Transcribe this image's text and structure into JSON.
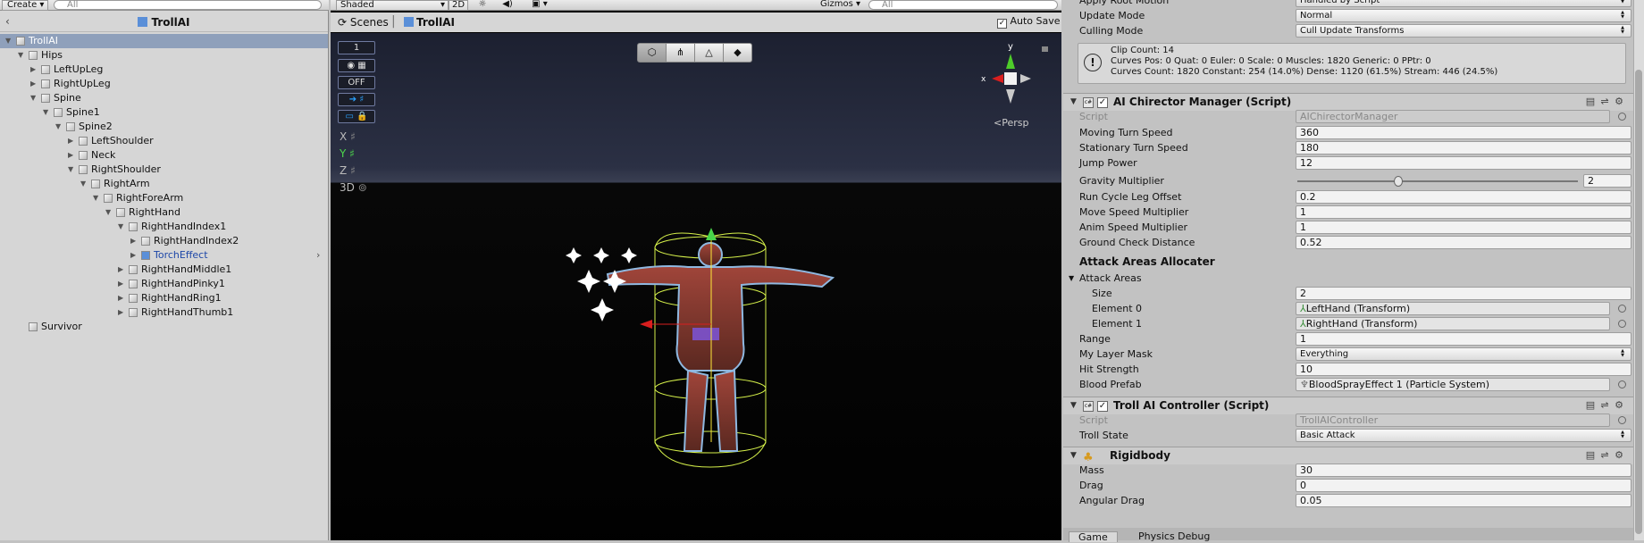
{
  "hierarchy": {
    "create_label": "Create",
    "search_placeholder": "All",
    "scene_title": "TrollAI",
    "items": [
      {
        "label": "TrollAI",
        "indent": 0,
        "arrow": "open",
        "selected": true
      },
      {
        "label": "Hips",
        "indent": 1,
        "arrow": "open"
      },
      {
        "label": "LeftUpLeg",
        "indent": 2,
        "arrow": "closed"
      },
      {
        "label": "RightUpLeg",
        "indent": 2,
        "arrow": "closed"
      },
      {
        "label": "Spine",
        "indent": 2,
        "arrow": "open"
      },
      {
        "label": "Spine1",
        "indent": 3,
        "arrow": "open"
      },
      {
        "label": "Spine2",
        "indent": 4,
        "arrow": "open"
      },
      {
        "label": "LeftShoulder",
        "indent": 5,
        "arrow": "closed"
      },
      {
        "label": "Neck",
        "indent": 5,
        "arrow": "closed"
      },
      {
        "label": "RightShoulder",
        "indent": 5,
        "arrow": "open"
      },
      {
        "label": "RightArm",
        "indent": 6,
        "arrow": "open"
      },
      {
        "label": "RightForeArm",
        "indent": 7,
        "arrow": "open"
      },
      {
        "label": "RightHand",
        "indent": 8,
        "arrow": "open"
      },
      {
        "label": "RightHandIndex1",
        "indent": 9,
        "arrow": "open"
      },
      {
        "label": "RightHandIndex2",
        "indent": 10,
        "arrow": "closed"
      },
      {
        "label": "TorchEffect",
        "indent": 10,
        "arrow": "closed",
        "prefab": true
      },
      {
        "label": "RightHandMiddle1",
        "indent": 9,
        "arrow": "closed"
      },
      {
        "label": "RightHandPinky1",
        "indent": 9,
        "arrow": "closed"
      },
      {
        "label": "RightHandRing1",
        "indent": 9,
        "arrow": "closed"
      },
      {
        "label": "RightHandThumb1",
        "indent": 9,
        "arrow": "closed"
      },
      {
        "label": "Survivor",
        "indent": 1,
        "arrow": "none"
      }
    ]
  },
  "scene_view": {
    "shading_mode": "Shaded",
    "mode_2d": "2D",
    "gizmos_label": "Gizmos",
    "search_placeholder": "All",
    "breadcrumb_root": "Scenes",
    "breadcrumb_current": "TrollAI",
    "auto_save_label": "Auto Save",
    "persp_label": "Persp",
    "left_controls": [
      "1",
      "",
      "OFF",
      "",
      ""
    ],
    "axes": [
      "X",
      "Y",
      "Z",
      "3D"
    ]
  },
  "inspector": {
    "top_rows": [
      {
        "label": "Apply Root Motion",
        "value": "Handled by Script"
      },
      {
        "label": "Update Mode",
        "value": "Normal"
      },
      {
        "label": "Culling Mode",
        "value": "Cull Update Transforms"
      }
    ],
    "info_lines": [
      "Clip Count: 14",
      "Curves Pos: 0 Quat: 0 Euler: 0 Scale: 0 Muscles: 1820 Generic: 0 PPtr: 0",
      "Curves Count: 1820 Constant: 254 (14.0%) Dense: 1120 (61.5%) Stream: 446 (24.5%)"
    ],
    "ai_manager": {
      "title": "AI Chirector Manager (Script)",
      "script_label": "Script",
      "script_value": "AIChirectorManager",
      "rows": [
        {
          "label": "Moving Turn Speed",
          "value": "360"
        },
        {
          "label": "Stationary Turn Speed",
          "value": "180"
        },
        {
          "label": "Jump Power",
          "value": "12"
        }
      ],
      "gravity_label": "Gravity Multiplier",
      "gravity_value": "2",
      "gravity_fraction": 0.36,
      "rows2": [
        {
          "label": "Run Cycle Leg Offset",
          "value": "0.2"
        },
        {
          "label": "Move Speed Multiplier",
          "value": "1"
        },
        {
          "label": "Anim Speed Multiplier",
          "value": "1"
        },
        {
          "label": "Ground Check Distance",
          "value": "0.52"
        }
      ],
      "section_title": "Attack Areas Allocater",
      "attack_areas_label": "Attack Areas",
      "size_label": "Size",
      "size_value": "2",
      "element0_label": "Element 0",
      "element0_value": "LeftHand (Transform)",
      "element1_label": "Element 1",
      "element1_value": "RightHand (Transform)",
      "range_label": "Range",
      "range_value": "1",
      "layer_label": "My Layer Mask",
      "layer_value": "Everything",
      "hit_label": "Hit Strength",
      "hit_value": "10",
      "blood_label": "Blood Prefab",
      "blood_value": "BloodSprayEffect 1 (Particle System)"
    },
    "troll_controller": {
      "title": "Troll AI Controller (Script)",
      "script_label": "Script",
      "script_value": "TrollAIController",
      "state_label": "Troll State",
      "state_value": "Basic Attack"
    },
    "rigidbody": {
      "title": "Rigidbody",
      "mass_label": "Mass",
      "mass_value": "30",
      "drag_label": "Drag",
      "drag_value": "0",
      "angular_label": "Angular Drag",
      "angular_value": "0.05"
    },
    "bottom_tabs": [
      "Game",
      "Physics Debug"
    ]
  }
}
